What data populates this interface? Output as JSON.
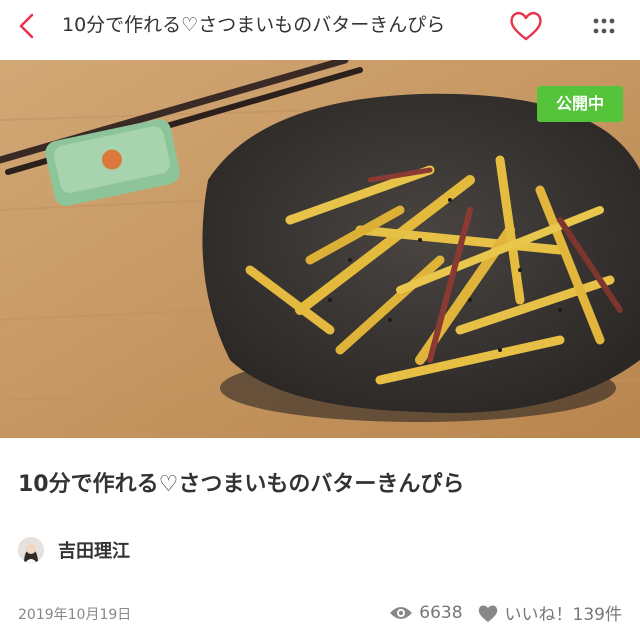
{
  "header": {
    "title": "10分で作れる♡さつまいものバターきんぴら",
    "back_icon": "chevron-left-icon",
    "favorite_icon": "heart-outline-icon",
    "more_icon": "vertical-dots-icon"
  },
  "hero": {
    "status_badge": "公開中",
    "badge_color": "#55c43a"
  },
  "recipe": {
    "title": "10分で作れる♡さつまいものバターきんぴら"
  },
  "author": {
    "name": "吉田理江"
  },
  "meta": {
    "date": "2019年10月19日",
    "view_count": "6638",
    "likes_label": "いいね！139件"
  },
  "colors": {
    "accent": "#e8334a",
    "text": "#333333",
    "muted": "#888888"
  }
}
